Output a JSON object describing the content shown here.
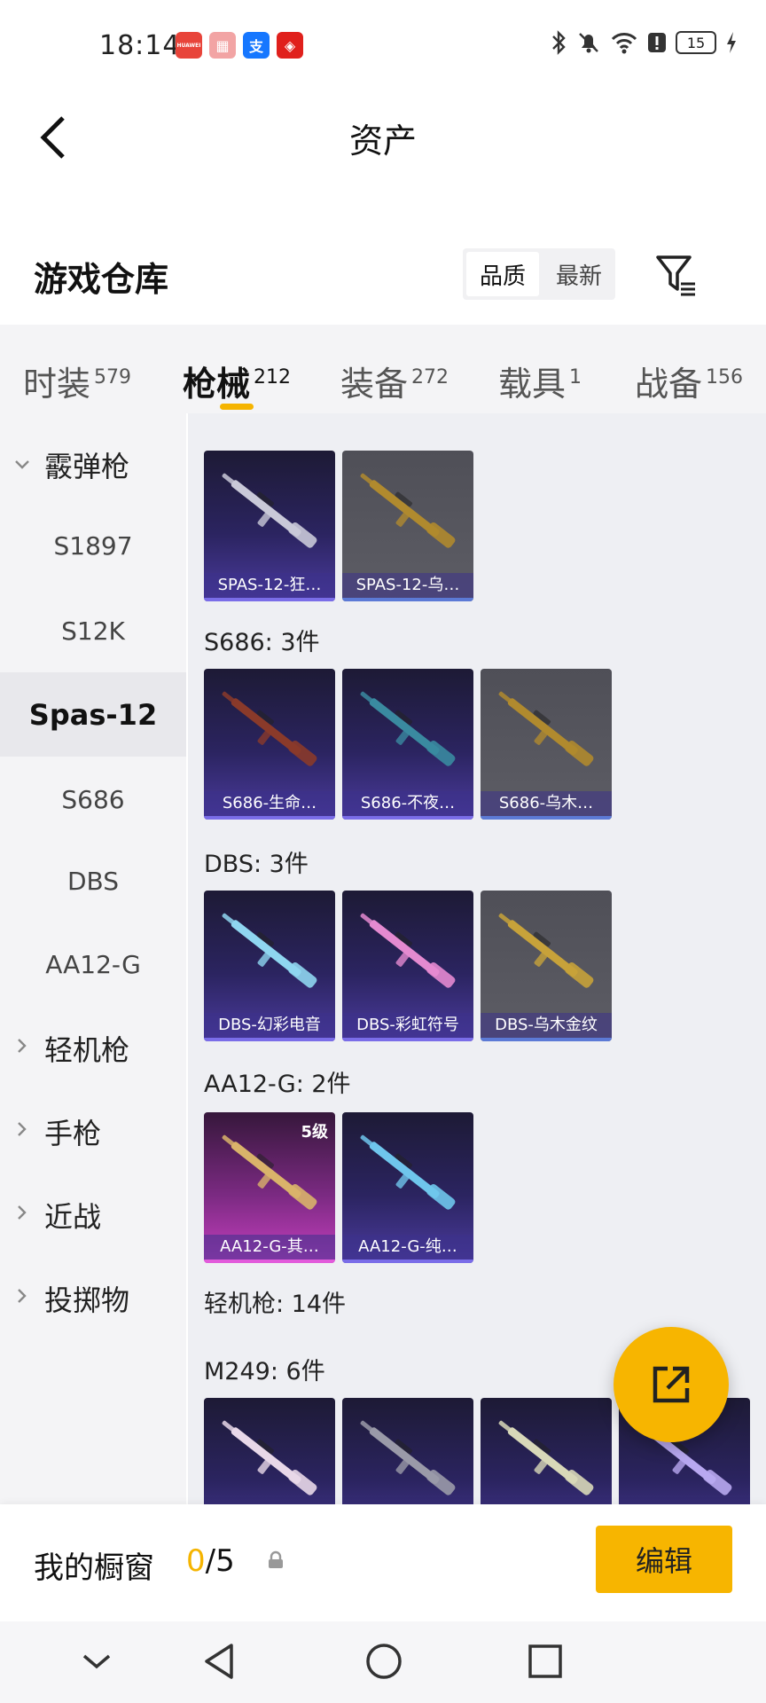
{
  "status_bar": {
    "time": "18:14",
    "apps": [
      {
        "name": "huawei-app-icon",
        "label": "HUAWEI",
        "color": "#e8443a"
      },
      {
        "name": "box-app-icon",
        "label": "▦",
        "color": "#f2a4a4"
      },
      {
        "name": "alipay-app-icon",
        "label": "支",
        "color": "#1677ff"
      },
      {
        "name": "red-app-icon",
        "label": "◈",
        "color": "#e0201c"
      }
    ],
    "battery": "15"
  },
  "header": {
    "title": "资产"
  },
  "section": {
    "title": "游戏仓库",
    "sort_options": [
      "品质",
      "最新"
    ]
  },
  "tabs": [
    {
      "label": "时装",
      "count": "579"
    },
    {
      "label": "枪械",
      "count": "212"
    },
    {
      "label": "装备",
      "count": "272"
    },
    {
      "label": "载具",
      "count": "1"
    },
    {
      "label": "战备",
      "count": "156"
    }
  ],
  "sidebar": {
    "items": [
      {
        "label": "霰弹枪",
        "type": "category",
        "expanded": true
      },
      {
        "label": "S1897",
        "type": "sub"
      },
      {
        "label": "S12K",
        "type": "sub"
      },
      {
        "label": "Spas-12",
        "type": "sub",
        "active": true
      },
      {
        "label": "S686",
        "type": "sub"
      },
      {
        "label": "DBS",
        "type": "sub"
      },
      {
        "label": "AA12-G",
        "type": "sub"
      },
      {
        "label": "轻机枪",
        "type": "category"
      },
      {
        "label": "手枪",
        "type": "category"
      },
      {
        "label": "近战",
        "type": "category"
      },
      {
        "label": "投掷物",
        "type": "category"
      }
    ]
  },
  "content": {
    "groups": [
      {
        "label": "",
        "items": [
          {
            "name": "SPAS-12-狂…",
            "rarity": "purple",
            "weapon_color": "#c9c9d8"
          },
          {
            "name": "SPAS-12-乌…",
            "rarity": "gray",
            "weapon_color": "#b08a2e"
          }
        ]
      },
      {
        "label": "S686: 3件",
        "items": [
          {
            "name": "S686-生命…",
            "rarity": "purple",
            "weapon_color": "#8a3a2a"
          },
          {
            "name": "S686-不夜…",
            "rarity": "purple",
            "weapon_color": "#3a8aa0"
          },
          {
            "name": "S686-乌木…",
            "rarity": "gray",
            "weapon_color": "#b08a2e"
          }
        ]
      },
      {
        "label": "DBS: 3件",
        "items": [
          {
            "name": "DBS-幻彩电音",
            "rarity": "purple",
            "weapon_color": "#8fd6f0"
          },
          {
            "name": "DBS-彩虹符号",
            "rarity": "purple",
            "weapon_color": "#e48ad0"
          },
          {
            "name": "DBS-乌木金纹",
            "rarity": "gray",
            "weapon_color": "#c7a23a"
          }
        ]
      },
      {
        "label": "AA12-G: 2件",
        "items": [
          {
            "name": "AA12-G-其…",
            "rarity": "pink",
            "weapon_color": "#d9b36a",
            "level": "5级"
          },
          {
            "name": "AA12-G-纯…",
            "rarity": "purple",
            "weapon_color": "#6fc6ec"
          }
        ]
      }
    ],
    "category_label": "轻机枪: 14件",
    "m249": {
      "label": "M249: 6件",
      "items": [
        {
          "rarity": "purple",
          "weapon_color": "#e8d8e8"
        },
        {
          "rarity": "purple",
          "weapon_color": "#9a9aa8"
        },
        {
          "rarity": "purple",
          "weapon_color": "#d8d8b8"
        },
        {
          "rarity": "purple",
          "weapon_color": "#b8a8f0"
        }
      ]
    }
  },
  "showcase": {
    "label": "我的橱窗",
    "current": "0",
    "max": "/5",
    "edit_label": "编辑"
  }
}
